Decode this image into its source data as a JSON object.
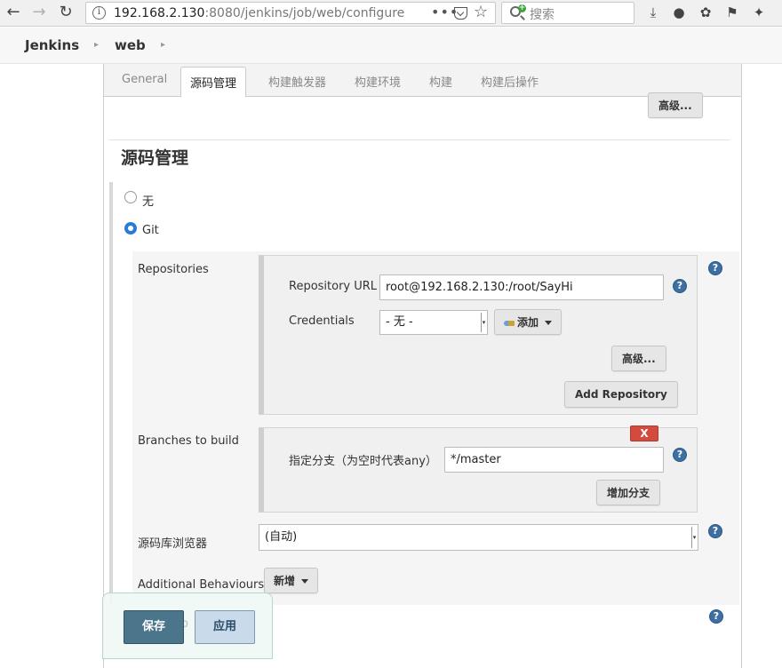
{
  "browser": {
    "url_host": "192.168.2.130",
    "url_rest": ":8080/jenkins/job/web/configure",
    "search_placeholder": "搜索",
    "more_glyph": "•••"
  },
  "breadcrumbs": [
    {
      "label": "Jenkins"
    },
    {
      "label": "web"
    }
  ],
  "tabs": [
    {
      "label": "General"
    },
    {
      "label": "源码管理"
    },
    {
      "label": "构建触发器"
    },
    {
      "label": "构建环境"
    },
    {
      "label": "构建"
    },
    {
      "label": "构建后操作"
    }
  ],
  "general": {
    "advanced_label": "高级..."
  },
  "scm": {
    "section_title": "源码管理",
    "options": [
      {
        "label": "无",
        "selected": false
      },
      {
        "label": "Git",
        "selected": true
      }
    ],
    "repositories_label": "Repositories",
    "repo_url_label": "Repository URL",
    "repo_url_value": "root@192.168.2.130:/root/SayHi",
    "credentials_label": "Credentials",
    "credentials_value": "- 无 -",
    "add_credentials_label": "添加",
    "repo_advanced_label": "高级...",
    "add_repository_label": "Add Repository",
    "branches_label": "Branches to build",
    "branch_specifier_label": "指定分支（为空时代表any）",
    "branch_specifier_value": "*/master",
    "delete_label": "X",
    "add_branch_label": "增加分支",
    "browser_label": "源码库浏览器",
    "browser_value": "(自动)",
    "behaviours_label": "Additional Behaviours",
    "add_behaviour_label": "新增",
    "help_glyph": "?"
  },
  "savebar": {
    "save_label": "保存",
    "apply_label": "应用",
    "hidden_label": "o"
  }
}
